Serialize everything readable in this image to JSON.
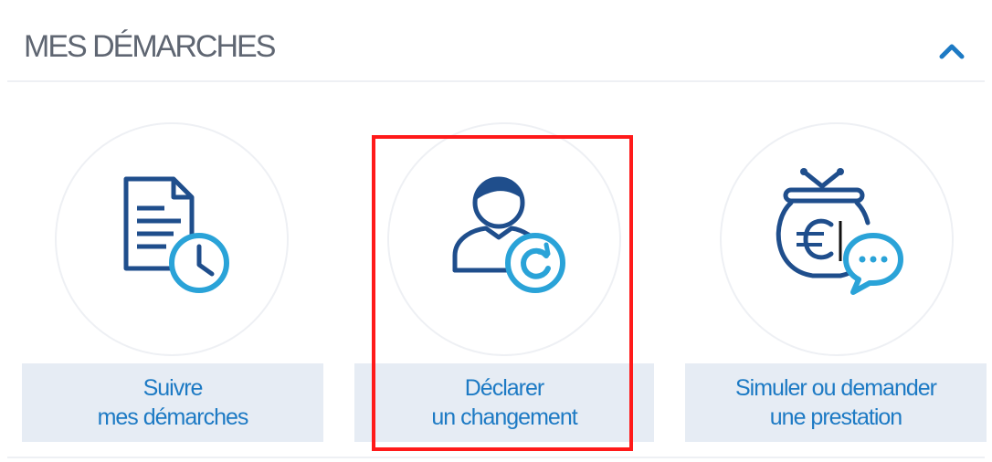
{
  "section": {
    "title": "MES DÉMARCHES",
    "collapse_icon": "chevron-up-icon"
  },
  "tiles": [
    {
      "icon": "document-clock-icon",
      "label_line1": "Suivre",
      "label_line2": "mes démarches"
    },
    {
      "icon": "user-refresh-icon",
      "label_line1": "Déclarer",
      "label_line2": "un changement"
    },
    {
      "icon": "money-bag-chat-icon",
      "label_line1": "Simuler ou demander",
      "label_line2": "une prestation"
    }
  ],
  "colors": {
    "icon_dark_blue": "#1f4e8c",
    "icon_light_blue": "#2aa3d8",
    "label_text": "#1d7ac4",
    "label_bg": "#e6ecf4",
    "highlight": "#ff1a1a",
    "title_text": "#5f6672"
  }
}
